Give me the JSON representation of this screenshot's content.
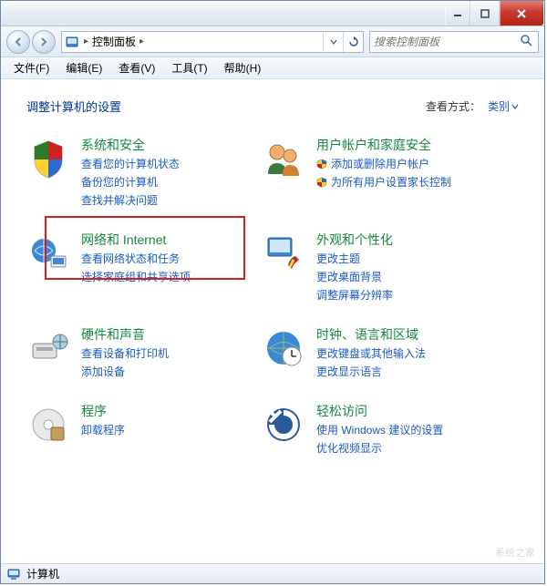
{
  "addressbar": {
    "path": "控制面板",
    "sep": "▸"
  },
  "search": {
    "placeholder": "搜索控制面板"
  },
  "menu": {
    "file": "文件(F)",
    "edit": "编辑(E)",
    "view": "查看(V)",
    "tools": "工具(T)",
    "help": "帮助(H)"
  },
  "page": {
    "title": "调整计算机的设置",
    "viewby_label": "查看方式：",
    "viewby_value": "类别"
  },
  "cats": [
    {
      "title": "系统和安全",
      "links": [
        {
          "t": "查看您的计算机状态"
        },
        {
          "t": "备份您的计算机"
        },
        {
          "t": "查找并解决问题"
        }
      ]
    },
    {
      "title": "用户帐户和家庭安全",
      "links": [
        {
          "t": "添加或删除用户帐户",
          "s": true
        },
        {
          "t": "为所有用户设置家长控制",
          "s": true
        }
      ]
    },
    {
      "title": "网络和 Internet",
      "links": [
        {
          "t": "查看网络状态和任务"
        },
        {
          "t": "选择家庭组和共享选项"
        }
      ]
    },
    {
      "title": "外观和个性化",
      "links": [
        {
          "t": "更改主题"
        },
        {
          "t": "更改桌面背景"
        },
        {
          "t": "调整屏幕分辨率"
        }
      ]
    },
    {
      "title": "硬件和声音",
      "links": [
        {
          "t": "查看设备和打印机"
        },
        {
          "t": "添加设备"
        }
      ]
    },
    {
      "title": "时钟、语言和区域",
      "links": [
        {
          "t": "更改键盘或其他输入法"
        },
        {
          "t": "更改显示语言"
        }
      ]
    },
    {
      "title": "程序",
      "links": [
        {
          "t": "卸载程序"
        }
      ]
    },
    {
      "title": "轻松访问",
      "links": [
        {
          "t": "使用 Windows 建议的设置"
        },
        {
          "t": "优化视频显示"
        }
      ]
    }
  ],
  "status": {
    "text": "计算机"
  }
}
